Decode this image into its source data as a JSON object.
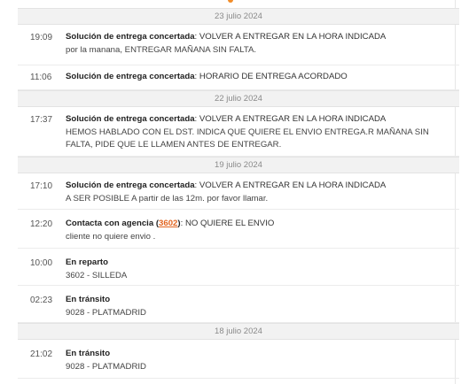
{
  "sections": [
    {
      "date": "23 julio 2024",
      "events": [
        {
          "time": "19:09",
          "title": "Solución de entrega concertada",
          "detail": "VOLVER A ENTREGAR EN LA HORA INDICADA",
          "lines": [
            "por la manana, ENTREGAR MAÑANA SIN FALTA."
          ]
        },
        {
          "time": "11:06",
          "title": "Solución de entrega concertada",
          "detail": "HORARIO DE ENTREGA ACORDADO",
          "lines": []
        }
      ]
    },
    {
      "date": "22 julio 2024",
      "events": [
        {
          "time": "17:37",
          "title": "Solución de entrega concertada",
          "detail": "VOLVER A ENTREGAR EN LA HORA INDICADA",
          "lines": [
            "HEMOS HABLADO CON EL DST. INDICA QUE QUIERE EL ENVIO ENTREGA.R MAÑANA SIN",
            "FALTA, PIDE QUE LE LLAMEN ANTES DE ENTREGAR."
          ]
        }
      ]
    },
    {
      "date": "19 julio 2024",
      "events": [
        {
          "time": "17:10",
          "title": "Solución de entrega concertada",
          "detail": "VOLVER A ENTREGAR EN LA HORA INDICADA",
          "lines": [
            "A SER POSIBLE A partir de las 12m. por favor llamar."
          ]
        },
        {
          "time": "12:20",
          "title": "Contacta con agencia",
          "agency_code": "3602",
          "detail": "NO QUIERE EL ENVIO",
          "lines": [
            "cliente no quiere envio ."
          ]
        },
        {
          "time": "10:00",
          "title": "En reparto",
          "lines": [
            "3602 - SILLEDA"
          ]
        },
        {
          "time": "02:23",
          "title": "En tránsito",
          "lines": [
            "9028 - PLATMADRID"
          ]
        }
      ]
    },
    {
      "date": "18 julio 2024",
      "events": [
        {
          "time": "21:02",
          "title": "En tránsito",
          "lines": [
            "9028 - PLATMADRID"
          ]
        }
      ]
    }
  ],
  "colors": {
    "accent": "#e2641f",
    "separator_bg": "#f2f2f2"
  }
}
